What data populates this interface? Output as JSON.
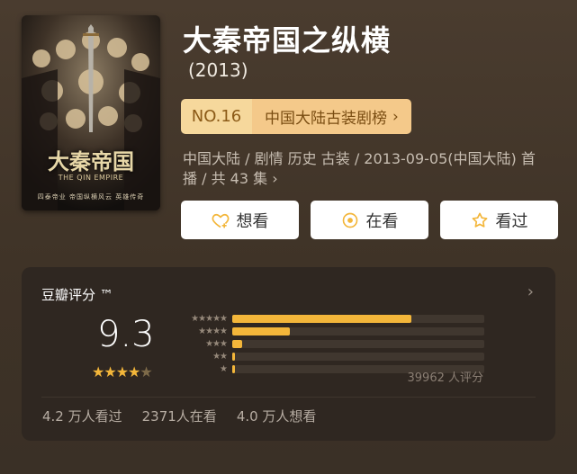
{
  "poster": {
    "title": "大秦帝国",
    "subtitle": "THE QIN EMPIRE",
    "tagline": "四泰帝业   帝国纵横风云   英雄传奇"
  },
  "show": {
    "title": "大秦帝国之纵横",
    "year": "(2013)",
    "rank_no": "NO.16",
    "rank_list": "中国大陆古装剧榜",
    "meta_line1": "中国大陆 / 剧情 历史 古装 / 2013-09-05(中国大陆) 首",
    "meta_line2": "播 / 共 43 集"
  },
  "actions": {
    "want": "想看",
    "watching": "在看",
    "watched": "看过"
  },
  "rating": {
    "header": "豆瓣评分 ™",
    "score": "9.3",
    "votes": "39962 人评分",
    "distribution": [
      0.71,
      0.23,
      0.04,
      0.01,
      0.01
    ],
    "accent": "#f3b63a"
  },
  "stats": {
    "watched": "4.2 万人看过",
    "watching": "2371人在看",
    "want": "4.0 万人想看"
  }
}
